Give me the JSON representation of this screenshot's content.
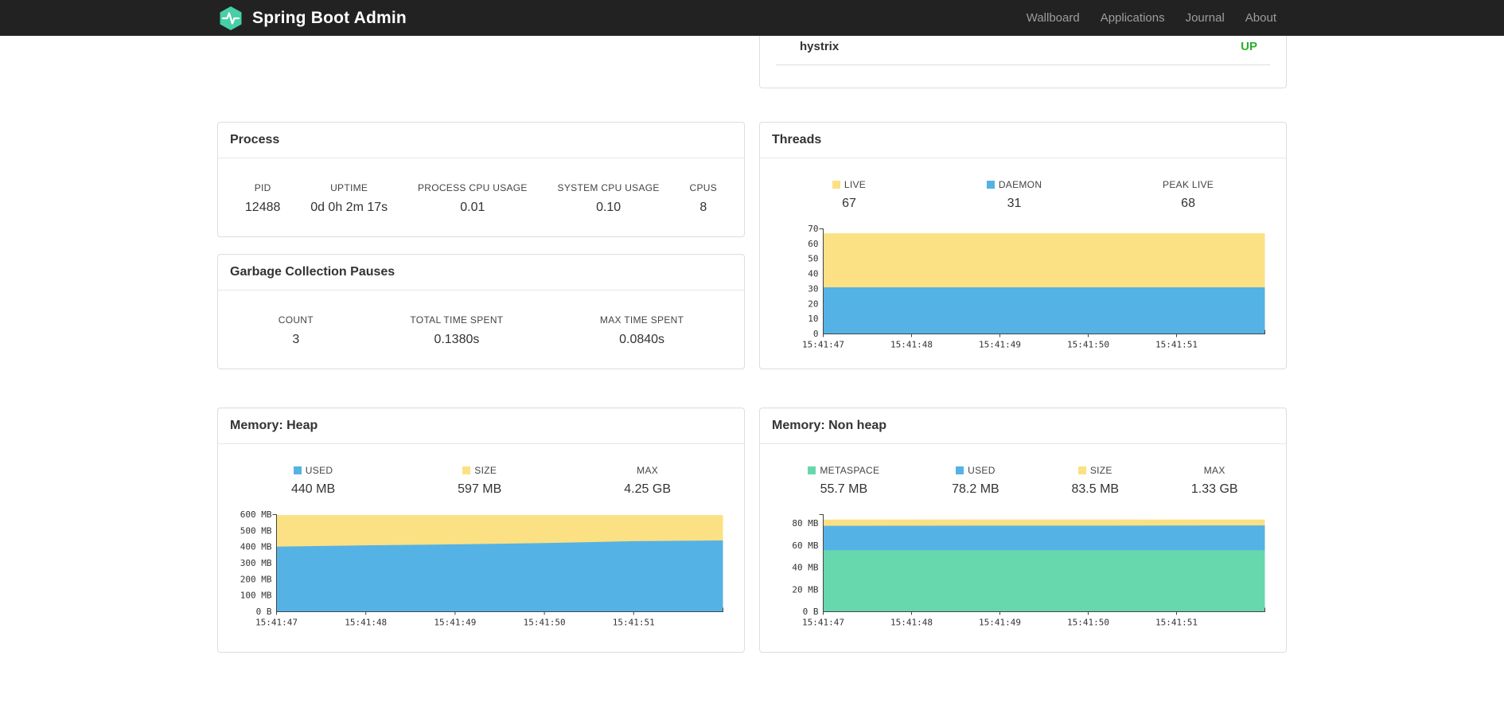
{
  "colors": {
    "brand_teal": "#47cfa7",
    "status_up_green": "#2ab02a",
    "chart_yellow": "#fbe183",
    "chart_blue": "#55b2e5",
    "chart_green": "#67d7ad",
    "navbar_bg": "#222222"
  },
  "navbar": {
    "brand": "Spring Boot Admin",
    "links": [
      "Wallboard",
      "Applications",
      "Journal",
      "About"
    ]
  },
  "health_panel": {
    "rows": [
      {
        "name": "hystrix",
        "status": "UP"
      }
    ]
  },
  "process_panel": {
    "title": "Process",
    "metrics": [
      {
        "label": "PID",
        "value": "12488"
      },
      {
        "label": "UPTIME",
        "value": "0d 0h 2m 17s"
      },
      {
        "label": "PROCESS CPU USAGE",
        "value": "0.01"
      },
      {
        "label": "SYSTEM CPU USAGE",
        "value": "0.10"
      },
      {
        "label": "CPUS",
        "value": "8"
      }
    ]
  },
  "gc_panel": {
    "title": "Garbage Collection Pauses",
    "metrics": [
      {
        "label": "COUNT",
        "value": "3"
      },
      {
        "label": "TOTAL TIME SPENT",
        "value": "0.1380s"
      },
      {
        "label": "MAX TIME SPENT",
        "value": "0.0840s"
      }
    ]
  },
  "threads_panel": {
    "title": "Threads",
    "legend": [
      {
        "label": "LIVE",
        "value": "67",
        "swatch": "yellow"
      },
      {
        "label": "DAEMON",
        "value": "31",
        "swatch": "blue"
      },
      {
        "label": "PEAK LIVE",
        "value": "68",
        "swatch": "none"
      }
    ]
  },
  "heap_panel": {
    "title": "Memory: Heap",
    "legend": [
      {
        "label": "USED",
        "value": "440 MB",
        "swatch": "blue"
      },
      {
        "label": "SIZE",
        "value": "597 MB",
        "swatch": "yellow"
      },
      {
        "label": "MAX",
        "value": "4.25 GB",
        "swatch": "none"
      }
    ]
  },
  "nonheap_panel": {
    "title": "Memory: Non heap",
    "legend": [
      {
        "label": "METASPACE",
        "value": "55.7 MB",
        "swatch": "green"
      },
      {
        "label": "USED",
        "value": "78.2 MB",
        "swatch": "blue"
      },
      {
        "label": "SIZE",
        "value": "83.5 MB",
        "swatch": "yellow"
      },
      {
        "label": "MAX",
        "value": "1.33 GB",
        "swatch": "none"
      }
    ]
  },
  "chart_data": [
    {
      "id": "threads",
      "type": "area",
      "title": "Threads",
      "x_ticks": [
        "15:41:47",
        "15:41:48",
        "15:41:49",
        "15:41:50",
        "15:41:51"
      ],
      "ylim": [
        0,
        70
      ],
      "y_ticks": [
        {
          "v": 0,
          "label": "0"
        },
        {
          "v": 10,
          "label": "10"
        },
        {
          "v": 20,
          "label": "20"
        },
        {
          "v": 30,
          "label": "30"
        },
        {
          "v": 40,
          "label": "40"
        },
        {
          "v": 50,
          "label": "50"
        },
        {
          "v": 60,
          "label": "60"
        },
        {
          "v": 70,
          "label": "70"
        }
      ],
      "series": [
        {
          "name": "LIVE",
          "color": "#fbe183",
          "values": [
            67,
            67,
            67,
            67,
            67,
            67
          ]
        },
        {
          "name": "DAEMON",
          "color": "#55b2e5",
          "values": [
            31,
            31,
            31,
            31,
            31,
            31
          ]
        }
      ],
      "legend": {
        "LIVE": 67,
        "DAEMON": 31,
        "PEAK LIVE": 68
      }
    },
    {
      "id": "heap",
      "type": "area",
      "title": "Memory: Heap",
      "x_ticks": [
        "15:41:47",
        "15:41:48",
        "15:41:49",
        "15:41:50",
        "15:41:51"
      ],
      "ylim": [
        0,
        600
      ],
      "y_ticks": [
        {
          "v": 0,
          "label": "0 B"
        },
        {
          "v": 100,
          "label": "100 MB"
        },
        {
          "v": 200,
          "label": "200 MB"
        },
        {
          "v": 300,
          "label": "300 MB"
        },
        {
          "v": 400,
          "label": "400 MB"
        },
        {
          "v": 500,
          "label": "500 MB"
        },
        {
          "v": 600,
          "label": "600 MB"
        }
      ],
      "series": [
        {
          "name": "SIZE",
          "color": "#fbe183",
          "values": [
            597,
            597,
            597,
            597,
            597,
            597
          ]
        },
        {
          "name": "USED",
          "color": "#55b2e5",
          "values": [
            402,
            410,
            416,
            424,
            436,
            440
          ]
        }
      ],
      "legend": {
        "USED": "440 MB",
        "SIZE": "597 MB",
        "MAX": "4.25 GB"
      }
    },
    {
      "id": "nonheap",
      "type": "area",
      "title": "Memory: Non heap",
      "x_ticks": [
        "15:41:47",
        "15:41:48",
        "15:41:49",
        "15:41:50",
        "15:41:51"
      ],
      "ylim": [
        0,
        88
      ],
      "y_ticks": [
        {
          "v": 0,
          "label": "0 B"
        },
        {
          "v": 20,
          "label": "20 MB"
        },
        {
          "v": 40,
          "label": "40 MB"
        },
        {
          "v": 60,
          "label": "60 MB"
        },
        {
          "v": 80,
          "label": "80 MB"
        }
      ],
      "series": [
        {
          "name": "SIZE",
          "color": "#fbe183",
          "values": [
            83.5,
            83.5,
            83.5,
            83.5,
            83.5,
            83.5
          ]
        },
        {
          "name": "USED",
          "color": "#55b2e5",
          "values": [
            77.8,
            77.9,
            78.0,
            78.0,
            78.1,
            78.2
          ]
        },
        {
          "name": "METASPACE",
          "color": "#67d7ad",
          "values": [
            55.7,
            55.7,
            55.7,
            55.7,
            55.7,
            55.7
          ]
        }
      ],
      "legend": {
        "METASPACE": "55.7 MB",
        "USED": "78.2 MB",
        "SIZE": "83.5 MB",
        "MAX": "1.33 GB"
      }
    }
  ]
}
